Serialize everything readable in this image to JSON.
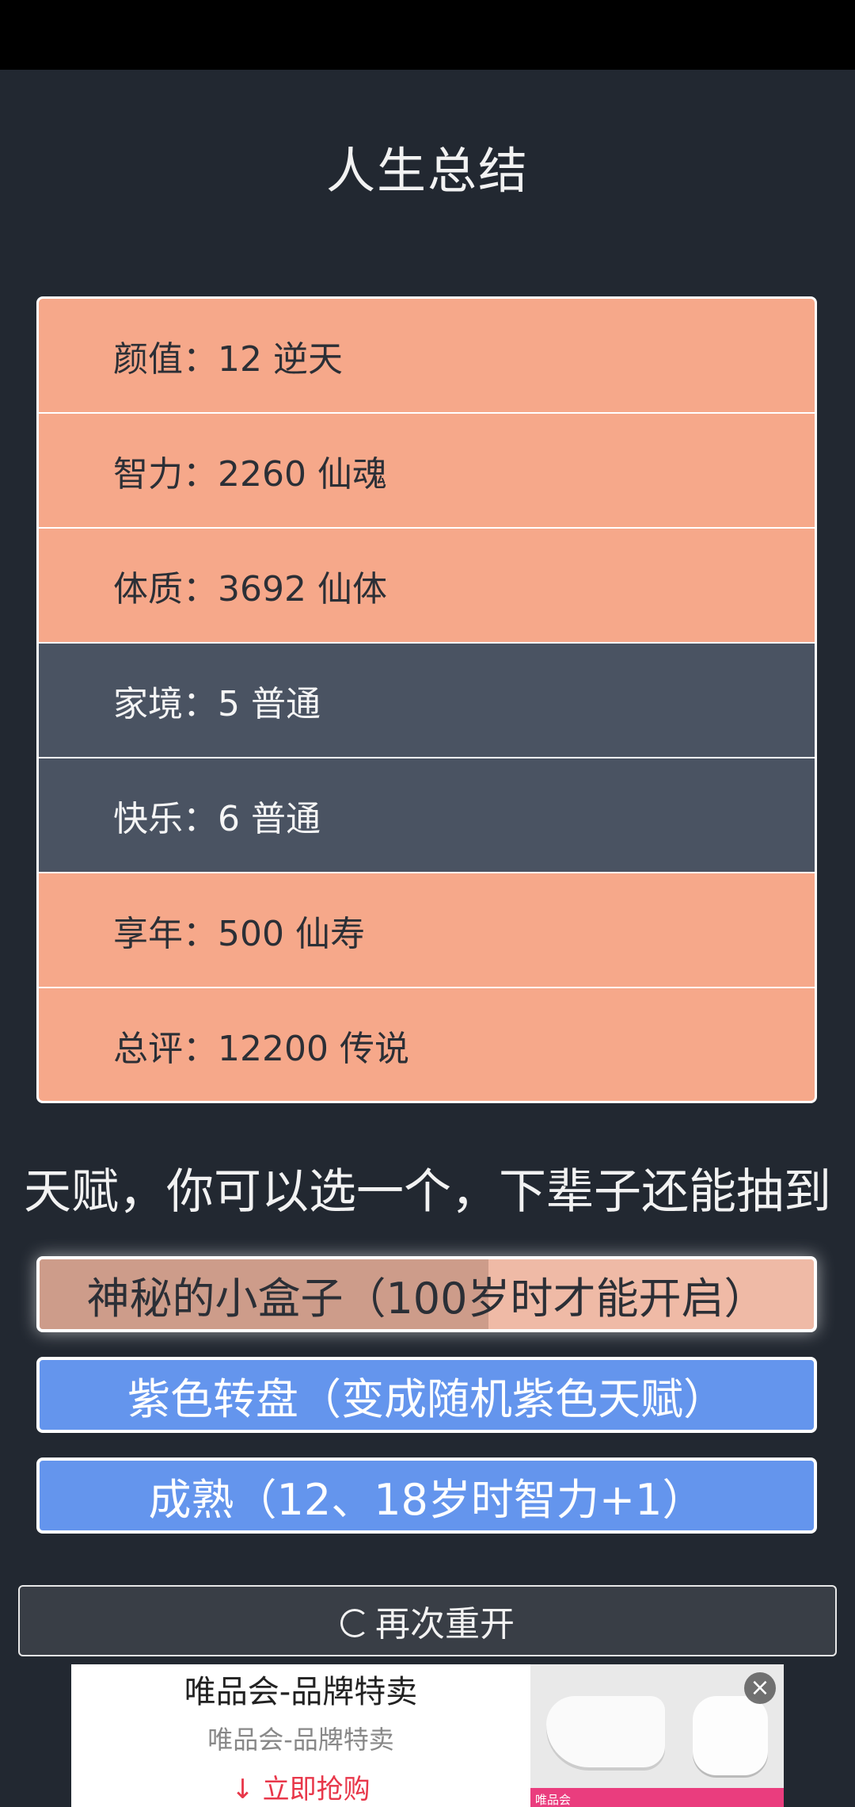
{
  "title": "人生总结",
  "summary_rows": [
    {
      "label": "颜值：12 逆天",
      "style": "orange"
    },
    {
      "label": "智力：2260 仙魂",
      "style": "orange"
    },
    {
      "label": "体质：3692 仙体",
      "style": "orange"
    },
    {
      "label": "家境：5 普通",
      "style": "dark"
    },
    {
      "label": "快乐：6 普通",
      "style": "dark"
    },
    {
      "label": "享年：500 仙寿",
      "style": "orange"
    },
    {
      "label": "总评：12200 传说",
      "style": "orange"
    }
  ],
  "talent_hint": "天赋，你可以选一个，下辈子还能抽到",
  "talents": [
    {
      "label": "神秘的小盒子（100岁时才能开启）",
      "progress": 0.58
    },
    {
      "label": "紫色转盘（变成随机紫色天赋）"
    },
    {
      "label": "成熟（12、18岁时智力+1）"
    }
  ],
  "restart_label": "再次重开",
  "ad": {
    "title": "唯品会-品牌特卖",
    "subtitle": "唯品会-品牌特卖",
    "cta": "立即抢购",
    "image_brand": "唯品会",
    "close_icon": "close-icon"
  },
  "colors": {
    "background": "#222831",
    "orange_row": "#f6a88a",
    "dark_row": "#4a5362",
    "blue_talent": "#6495ed",
    "cta_red": "#e8374a"
  }
}
